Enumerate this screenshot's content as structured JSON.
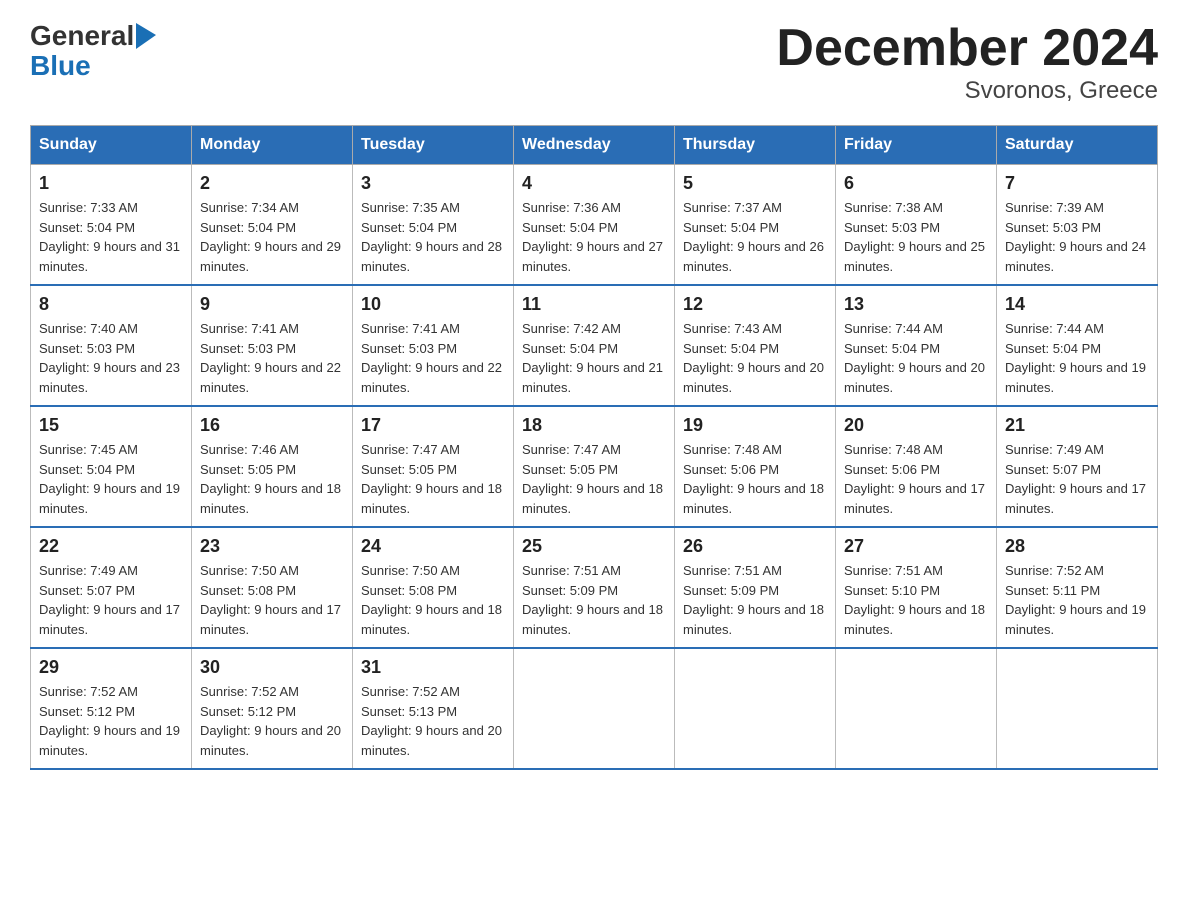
{
  "logo": {
    "general": "General",
    "blue": "Blue",
    "arrow_char": "▶"
  },
  "title": "December 2024",
  "subtitle": "Svoronos, Greece",
  "headers": [
    "Sunday",
    "Monday",
    "Tuesday",
    "Wednesday",
    "Thursday",
    "Friday",
    "Saturday"
  ],
  "weeks": [
    [
      {
        "day": "1",
        "sunrise": "7:33 AM",
        "sunset": "5:04 PM",
        "daylight": "9 hours and 31 minutes."
      },
      {
        "day": "2",
        "sunrise": "7:34 AM",
        "sunset": "5:04 PM",
        "daylight": "9 hours and 29 minutes."
      },
      {
        "day": "3",
        "sunrise": "7:35 AM",
        "sunset": "5:04 PM",
        "daylight": "9 hours and 28 minutes."
      },
      {
        "day": "4",
        "sunrise": "7:36 AM",
        "sunset": "5:04 PM",
        "daylight": "9 hours and 27 minutes."
      },
      {
        "day": "5",
        "sunrise": "7:37 AM",
        "sunset": "5:04 PM",
        "daylight": "9 hours and 26 minutes."
      },
      {
        "day": "6",
        "sunrise": "7:38 AM",
        "sunset": "5:03 PM",
        "daylight": "9 hours and 25 minutes."
      },
      {
        "day": "7",
        "sunrise": "7:39 AM",
        "sunset": "5:03 PM",
        "daylight": "9 hours and 24 minutes."
      }
    ],
    [
      {
        "day": "8",
        "sunrise": "7:40 AM",
        "sunset": "5:03 PM",
        "daylight": "9 hours and 23 minutes."
      },
      {
        "day": "9",
        "sunrise": "7:41 AM",
        "sunset": "5:03 PM",
        "daylight": "9 hours and 22 minutes."
      },
      {
        "day": "10",
        "sunrise": "7:41 AM",
        "sunset": "5:03 PM",
        "daylight": "9 hours and 22 minutes."
      },
      {
        "day": "11",
        "sunrise": "7:42 AM",
        "sunset": "5:04 PM",
        "daylight": "9 hours and 21 minutes."
      },
      {
        "day": "12",
        "sunrise": "7:43 AM",
        "sunset": "5:04 PM",
        "daylight": "9 hours and 20 minutes."
      },
      {
        "day": "13",
        "sunrise": "7:44 AM",
        "sunset": "5:04 PM",
        "daylight": "9 hours and 20 minutes."
      },
      {
        "day": "14",
        "sunrise": "7:44 AM",
        "sunset": "5:04 PM",
        "daylight": "9 hours and 19 minutes."
      }
    ],
    [
      {
        "day": "15",
        "sunrise": "7:45 AM",
        "sunset": "5:04 PM",
        "daylight": "9 hours and 19 minutes."
      },
      {
        "day": "16",
        "sunrise": "7:46 AM",
        "sunset": "5:05 PM",
        "daylight": "9 hours and 18 minutes."
      },
      {
        "day": "17",
        "sunrise": "7:47 AM",
        "sunset": "5:05 PM",
        "daylight": "9 hours and 18 minutes."
      },
      {
        "day": "18",
        "sunrise": "7:47 AM",
        "sunset": "5:05 PM",
        "daylight": "9 hours and 18 minutes."
      },
      {
        "day": "19",
        "sunrise": "7:48 AM",
        "sunset": "5:06 PM",
        "daylight": "9 hours and 18 minutes."
      },
      {
        "day": "20",
        "sunrise": "7:48 AM",
        "sunset": "5:06 PM",
        "daylight": "9 hours and 17 minutes."
      },
      {
        "day": "21",
        "sunrise": "7:49 AM",
        "sunset": "5:07 PM",
        "daylight": "9 hours and 17 minutes."
      }
    ],
    [
      {
        "day": "22",
        "sunrise": "7:49 AM",
        "sunset": "5:07 PM",
        "daylight": "9 hours and 17 minutes."
      },
      {
        "day": "23",
        "sunrise": "7:50 AM",
        "sunset": "5:08 PM",
        "daylight": "9 hours and 17 minutes."
      },
      {
        "day": "24",
        "sunrise": "7:50 AM",
        "sunset": "5:08 PM",
        "daylight": "9 hours and 18 minutes."
      },
      {
        "day": "25",
        "sunrise": "7:51 AM",
        "sunset": "5:09 PM",
        "daylight": "9 hours and 18 minutes."
      },
      {
        "day": "26",
        "sunrise": "7:51 AM",
        "sunset": "5:09 PM",
        "daylight": "9 hours and 18 minutes."
      },
      {
        "day": "27",
        "sunrise": "7:51 AM",
        "sunset": "5:10 PM",
        "daylight": "9 hours and 18 minutes."
      },
      {
        "day": "28",
        "sunrise": "7:52 AM",
        "sunset": "5:11 PM",
        "daylight": "9 hours and 19 minutes."
      }
    ],
    [
      {
        "day": "29",
        "sunrise": "7:52 AM",
        "sunset": "5:12 PM",
        "daylight": "9 hours and 19 minutes."
      },
      {
        "day": "30",
        "sunrise": "7:52 AM",
        "sunset": "5:12 PM",
        "daylight": "9 hours and 20 minutes."
      },
      {
        "day": "31",
        "sunrise": "7:52 AM",
        "sunset": "5:13 PM",
        "daylight": "9 hours and 20 minutes."
      },
      null,
      null,
      null,
      null
    ]
  ]
}
